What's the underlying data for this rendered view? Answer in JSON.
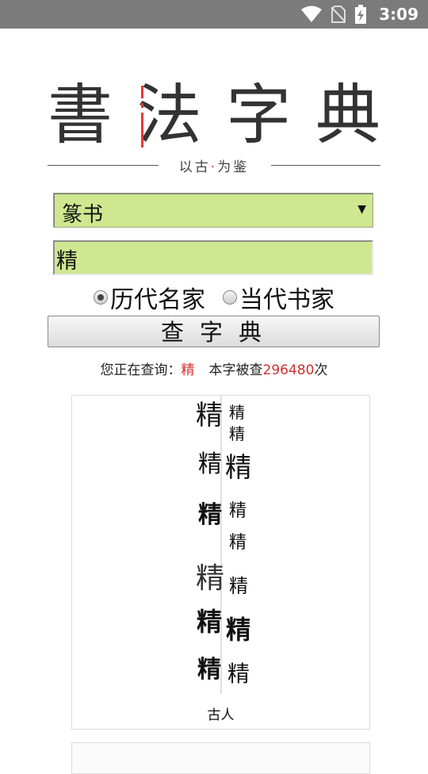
{
  "status_bar": {
    "time": "3:09",
    "icons": [
      "wifi-icon",
      "no-sim-icon",
      "battery-charging-icon"
    ]
  },
  "logo": {
    "title_chars": [
      "書",
      "法",
      "字",
      "典"
    ],
    "subtitle_left": "以古",
    "subtitle_dot": "·",
    "subtitle_right": "为鉴"
  },
  "form": {
    "script_select": {
      "value": "篆书"
    },
    "char_input": {
      "value": "精"
    },
    "radios": [
      {
        "label": "历代名家",
        "checked": true
      },
      {
        "label": "当代书家",
        "checked": false
      }
    ],
    "search_button": "查字典"
  },
  "info": {
    "prefix": "您正在查询：",
    "char": "精",
    "count_prefix": "本字被查",
    "count": "296480",
    "count_suffix": "次"
  },
  "results": [
    {
      "caption": "古人"
    }
  ],
  "colors": {
    "input_bg": "#cfe88f",
    "accent_red": "#d32f2f",
    "statusbar": "#7b7b7b"
  }
}
